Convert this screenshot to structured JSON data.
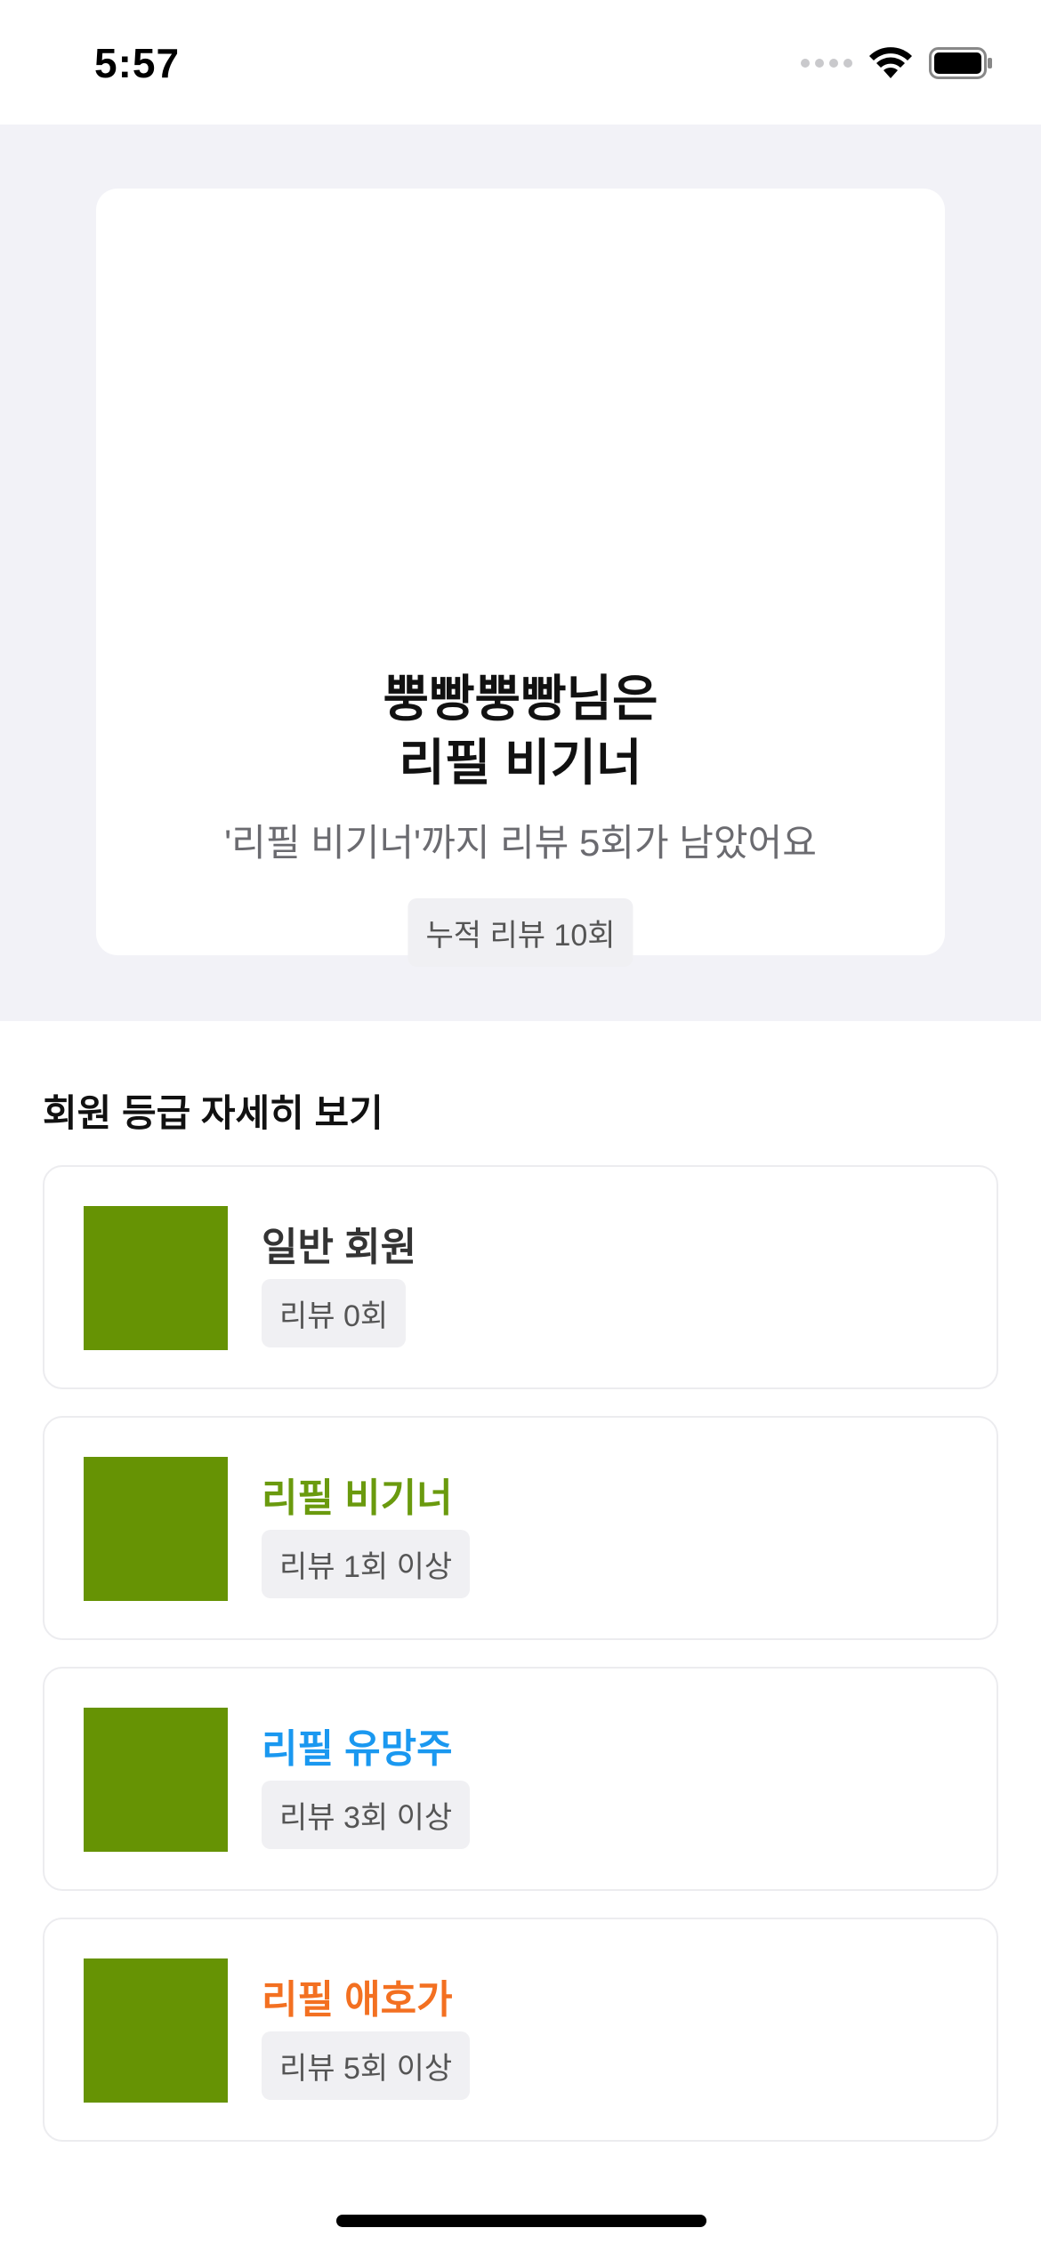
{
  "status_bar": {
    "time": "5:57",
    "icons": [
      "signal-dots-icon",
      "wifi-icon",
      "battery-icon"
    ]
  },
  "hero": {
    "title_line1": "뿡빵뿡빵님은",
    "title_line2": "리필 비기너",
    "subtitle": "'리필 비기너'까지 리뷰 5회가 남았어요",
    "badge": "누적 리뷰 10회"
  },
  "grades": {
    "section_title": "회원 등급 자세히 보기",
    "thumb_color": "#669304",
    "items": [
      {
        "name": "일반 회원",
        "requirement": "리뷰 0회",
        "color": "#333333"
      },
      {
        "name": "리필 비기너",
        "requirement": "리뷰 1회 이상",
        "color": "#6a9a0e"
      },
      {
        "name": "리필 유망주",
        "requirement": "리뷰 3회 이상",
        "color": "#1a98f0"
      },
      {
        "name": "리필 애호가",
        "requirement": "리뷰 5회 이상",
        "color": "#f37021"
      }
    ]
  }
}
